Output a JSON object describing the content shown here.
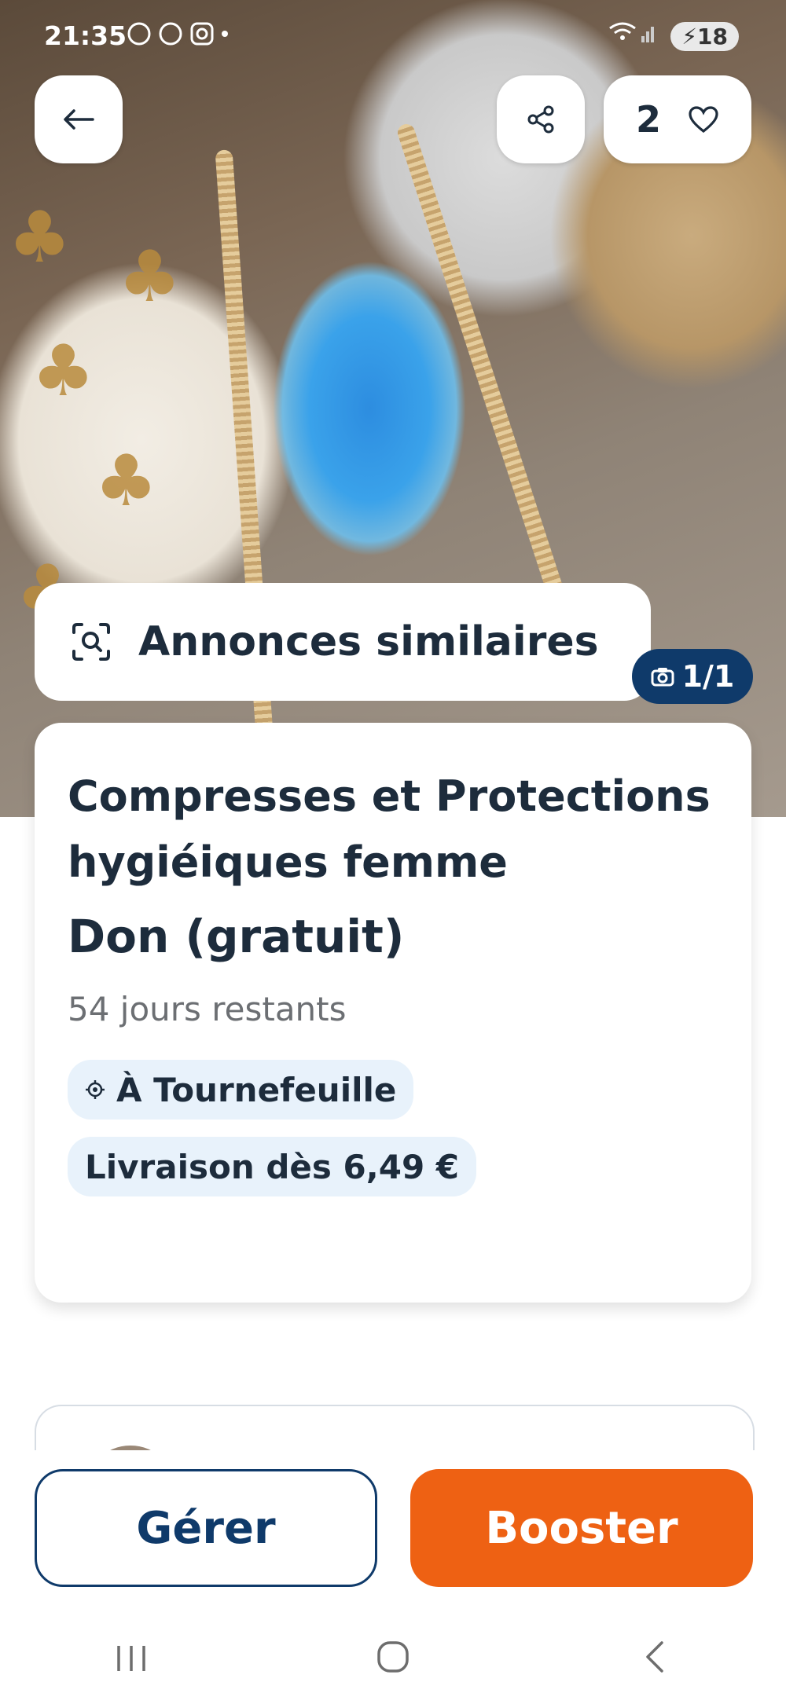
{
  "status_bar": {
    "time": "21:35",
    "battery": "18"
  },
  "header": {
    "favorite_count": "2"
  },
  "similar_ads": {
    "label": "Annonces similaires"
  },
  "photo_counter": "1/1",
  "listing": {
    "title": "Compresses et Protections hygiéiques femme",
    "price": "Don (gratuit)",
    "remaining": "54 jours restants",
    "location": "À Tournefeuille",
    "delivery": "Livraison dès 6,49 €"
  },
  "actions": {
    "manage": "Gérer",
    "boost": "Booster"
  },
  "icons": {
    "back": "arrow-left-icon",
    "share": "share-icon",
    "favorite": "heart-icon",
    "similar": "image-search-icon",
    "camera": "camera-icon",
    "location": "location-target-icon"
  },
  "colors": {
    "primary": "#0f3a6a",
    "accent": "#ee6113",
    "chip_bg": "#e8f2fb"
  }
}
